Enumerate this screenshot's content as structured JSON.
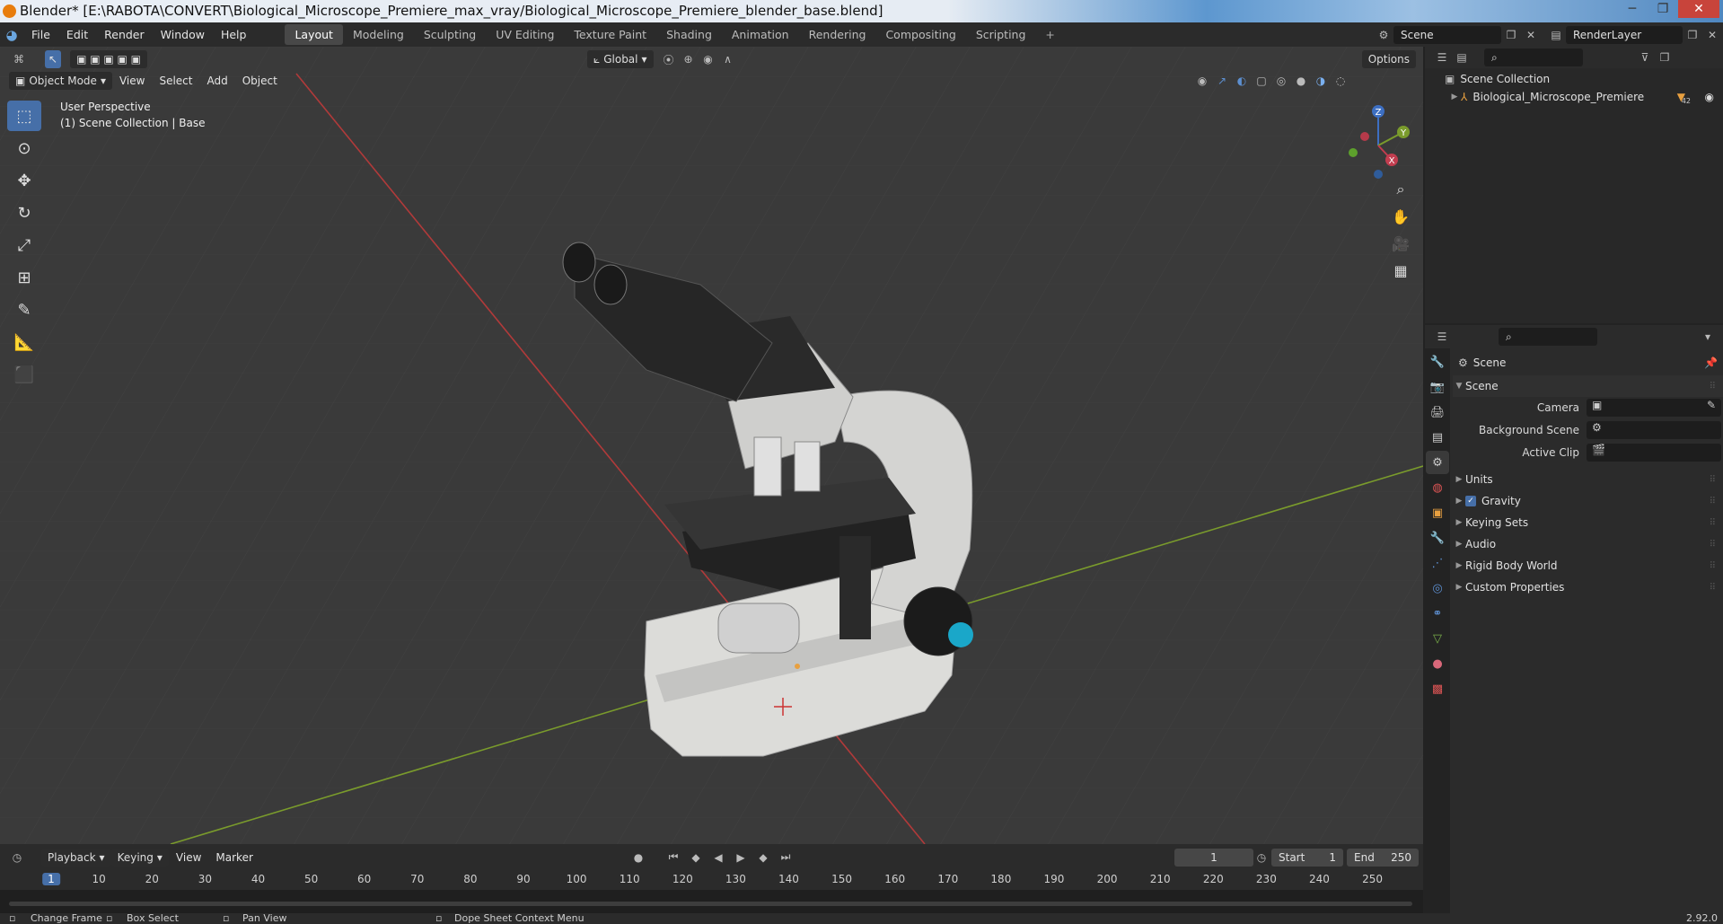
{
  "window": {
    "title": "Blender* [E:\\RABOTA\\CONVERT\\Biological_Microscope_Premiere_max_vray/Biological_Microscope_Premiere_blender_base.blend]",
    "buttons": [
      "─",
      "❐",
      "✕"
    ]
  },
  "topbar": {
    "menus": [
      "File",
      "Edit",
      "Render",
      "Window",
      "Help"
    ],
    "workspaces": [
      "Layout",
      "Modeling",
      "Sculpting",
      "UV Editing",
      "Texture Paint",
      "Shading",
      "Animation",
      "Rendering",
      "Compositing",
      "Scripting"
    ],
    "active_workspace": "Layout",
    "add_tab": "+",
    "scene": "Scene",
    "view_layer": "RenderLayer"
  },
  "viewport": {
    "mode": "Object Mode",
    "menus": [
      "View",
      "Select",
      "Add",
      "Object"
    ],
    "transform_orientation": "Global",
    "options": "Options",
    "overlay_title": "User Perspective",
    "overlay_collection": "(1) Scene Collection | Base",
    "gizmo_axes": [
      "Z",
      "Y",
      "X"
    ]
  },
  "timeline": {
    "menus": [
      "Playback",
      "Keying",
      "View",
      "Marker"
    ],
    "current_frame": "1",
    "start_label": "Start",
    "start": "1",
    "end_label": "End",
    "end": "250",
    "ruler": [
      "1",
      "10",
      "20",
      "30",
      "40",
      "50",
      "60",
      "70",
      "80",
      "90",
      "100",
      "110",
      "120",
      "130",
      "140",
      "150",
      "160",
      "170",
      "180",
      "190",
      "200",
      "210",
      "220",
      "230",
      "240",
      "250"
    ]
  },
  "statusbar": {
    "items": [
      "Change Frame",
      "Box Select",
      "Pan View",
      "Dope Sheet Context Menu"
    ],
    "version": "2.92.0"
  },
  "outliner": {
    "root": "Scene Collection",
    "item": "Biological_Microscope_Premiere",
    "item_badge": "42"
  },
  "properties": {
    "context": "Scene",
    "panel": "Scene",
    "fields": [
      {
        "label": "Camera"
      },
      {
        "label": "Background Scene"
      },
      {
        "label": "Active Clip"
      }
    ],
    "sections": [
      "Units",
      "Gravity",
      "Keying Sets",
      "Audio",
      "Rigid Body World",
      "Custom Properties"
    ],
    "gravity_checked": true
  },
  "colors": {
    "accent": "#466fa8",
    "x_axis": "#b13a3a",
    "y_axis": "#7a9b2c",
    "microscope_body": "#d8d8d6",
    "knob_blue": "#1aa7c9"
  }
}
